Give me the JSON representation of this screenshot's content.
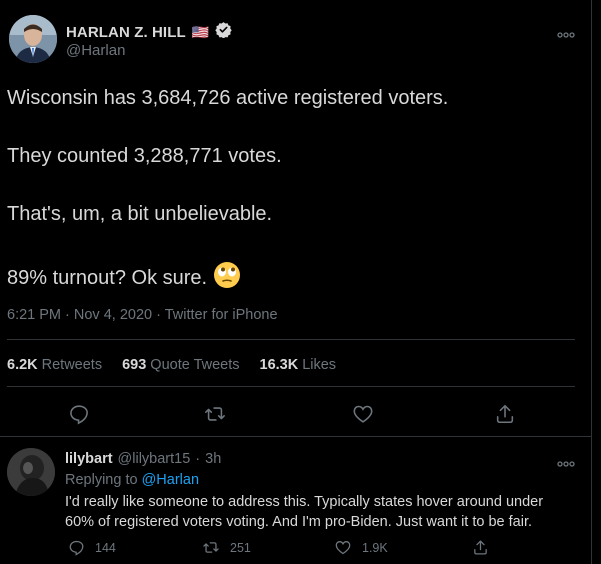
{
  "tweet": {
    "display_name": "HARLAN Z. HILL",
    "flag": "🇺🇸",
    "handle": "@Harlan",
    "lines": [
      "Wisconsin has 3,684,726 active registered voters.",
      "They counted 3,288,771 votes.",
      "That's, um, a bit unbelievable.",
      "89% turnout? Ok sure."
    ],
    "emoji": "🙄",
    "time": "6:21 PM",
    "date": "Nov 4, 2020",
    "source": "Twitter for iPhone",
    "stats": {
      "retweets_value": "6.2K",
      "retweets_label": "Retweets",
      "quotes_value": "693",
      "quotes_label": "Quote Tweets",
      "likes_value": "16.3K",
      "likes_label": "Likes"
    }
  },
  "reply": {
    "display_name": "lilybart",
    "handle": "@lilybart15",
    "time": "3h",
    "replying_prefix": "Replying to",
    "replying_handle": "@Harlan",
    "text": "I'd really like someone to address this.  Typically states hover around under 60% of registered voters voting.  And I'm pro-Biden.  Just want it to be fair.",
    "counts": {
      "replies": "144",
      "retweets": "251",
      "likes": "1.9K"
    }
  },
  "colors": {
    "background": "#000000",
    "text": "#d9d9d9",
    "muted": "#6e767d",
    "link": "#1da1f2",
    "divider": "#2f3336"
  }
}
